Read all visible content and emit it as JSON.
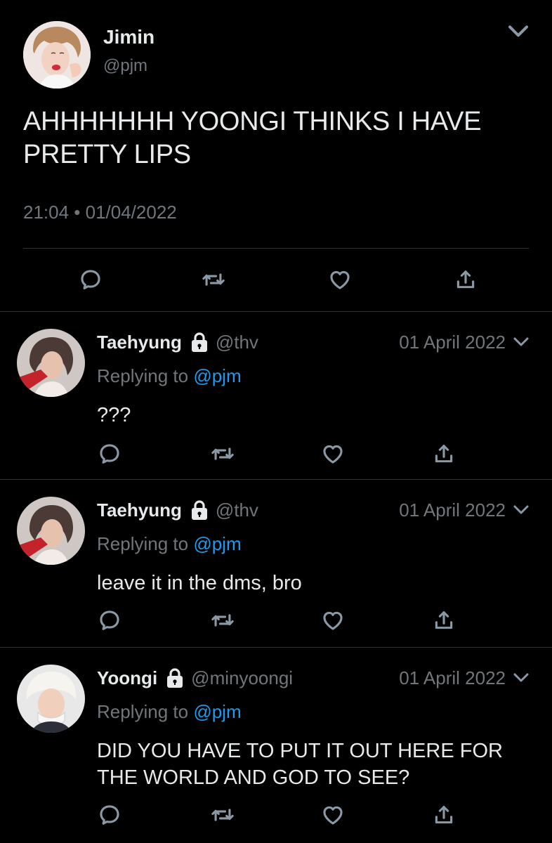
{
  "main_tweet": {
    "author_name": "Jimin",
    "author_handle": "@pjm",
    "text": "AHHHHHHH YOONGI THINKS I HAVE PRETTY LIPS",
    "timestamp": "21:04 • 01/04/2022",
    "icons": [
      "chevron-down-icon",
      "reply-icon",
      "retweet-icon",
      "like-icon",
      "share-icon"
    ]
  },
  "replies": [
    {
      "author_name": "Taehyung",
      "protected_icon": "lock-icon",
      "author_handle": "@thv",
      "date": "01 April 2022",
      "replying_prefix": "Replying to",
      "replying_to": "@pjm",
      "text": "???"
    },
    {
      "author_name": "Taehyung",
      "protected_icon": "lock-icon",
      "author_handle": "@thv",
      "date": "01 April 2022",
      "replying_prefix": "Replying to",
      "replying_to": "@pjm",
      "text": "leave it in the dms, bro"
    },
    {
      "author_name": "Yoongi",
      "protected_icon": "lock-icon",
      "author_handle": "@minyoongi",
      "date": "01 April 2022",
      "replying_prefix": "Replying to",
      "replying_to": "@pjm",
      "text": "DID YOU HAVE TO PUT IT OUT HERE FOR THE WORLD AND GOD TO SEE?"
    }
  ],
  "colors": {
    "background": "#000000",
    "primary_text": "#e7e9ea",
    "secondary_text": "#71767b",
    "mention": "#1d9bf0",
    "divider": "#2f3336"
  }
}
